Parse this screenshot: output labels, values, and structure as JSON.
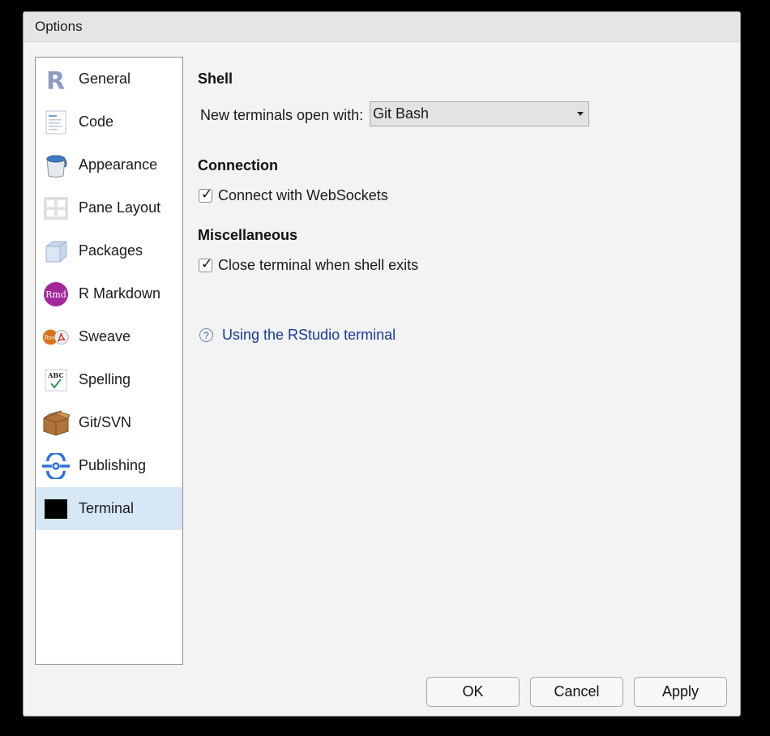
{
  "window": {
    "title": "Options"
  },
  "sidebar": {
    "items": [
      {
        "label": "General",
        "icon": "r-logo-icon"
      },
      {
        "label": "Code",
        "icon": "code-document-icon"
      },
      {
        "label": "Appearance",
        "icon": "paint-bucket-icon"
      },
      {
        "label": "Pane Layout",
        "icon": "pane-layout-icon"
      },
      {
        "label": "Packages",
        "icon": "package-cube-icon"
      },
      {
        "label": "R Markdown",
        "icon": "rmd-icon"
      },
      {
        "label": "Sweave",
        "icon": "sweave-icon"
      },
      {
        "label": "Spelling",
        "icon": "spelling-abc-icon"
      },
      {
        "label": "Git/SVN",
        "icon": "git-box-icon"
      },
      {
        "label": "Publishing",
        "icon": "publishing-icon"
      },
      {
        "label": "Terminal",
        "icon": "terminal-icon"
      }
    ],
    "selected": "Terminal"
  },
  "shell": {
    "title": "Shell",
    "label": "New terminals open with:",
    "value": "Git Bash"
  },
  "connection": {
    "title": "Connection",
    "websockets_label": "Connect with WebSockets",
    "websockets_checked": true
  },
  "misc": {
    "title": "Miscellaneous",
    "close_label": "Close terminal when shell exits",
    "close_checked": true
  },
  "help": {
    "label": "Using the RStudio terminal",
    "icon_glyph": "?"
  },
  "buttons": {
    "ok": "OK",
    "cancel": "Cancel",
    "apply": "Apply"
  },
  "colors": {
    "selected_bg": "#d6e7f6",
    "link": "#1a3a9a"
  }
}
